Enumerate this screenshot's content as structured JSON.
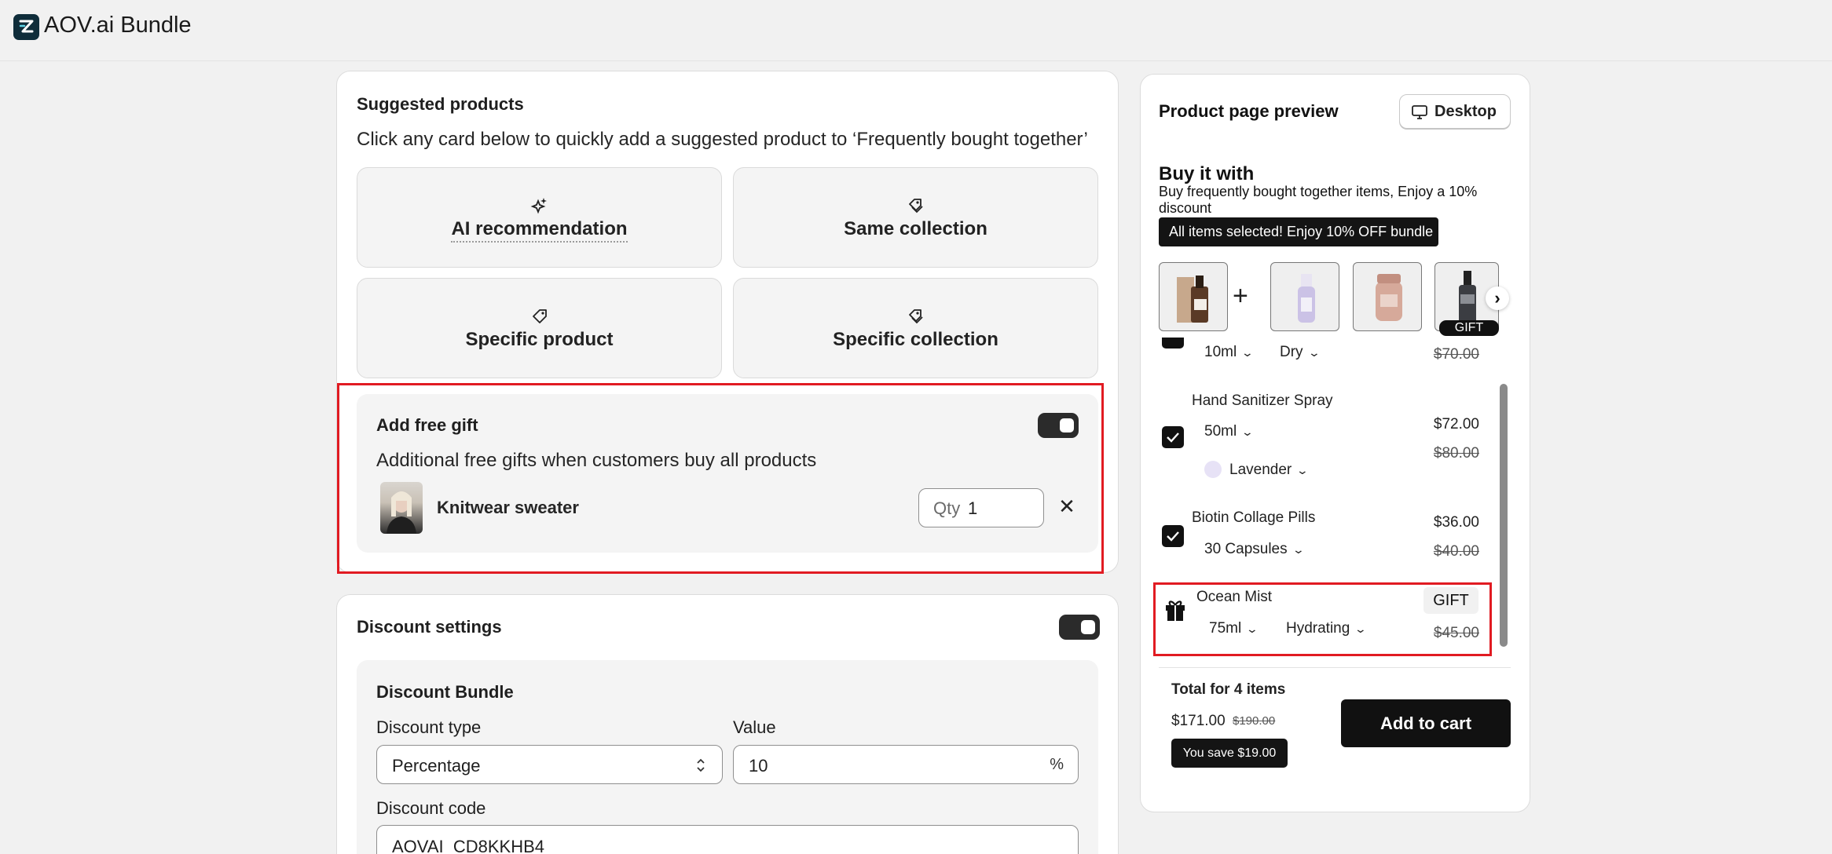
{
  "app": {
    "title": "AOV.ai Bundle"
  },
  "suggested": {
    "title": "Suggested products",
    "description": "Click any card below to quickly add a suggested product to ‘Frequently bought together’",
    "tiles": [
      {
        "label": "AI recommendation",
        "icon": "sparkle-icon"
      },
      {
        "label": "Same collection",
        "icon": "tags-icon"
      },
      {
        "label": "Specific product",
        "icon": "tag-icon"
      },
      {
        "label": "Specific collection",
        "icon": "tags-icon"
      }
    ]
  },
  "free_gift": {
    "title": "Add free gift",
    "enabled": true,
    "description": "Additional free gifts when customers buy all products",
    "item": {
      "name": "Knitwear sweater",
      "qty_label": "Qty",
      "qty": "1"
    }
  },
  "discount": {
    "title": "Discount settings",
    "enabled": true,
    "bundle_title": "Discount Bundle",
    "type_label": "Discount type",
    "type_value": "Percentage",
    "value_label": "Value",
    "value": "10",
    "value_suffix": "%",
    "code_label": "Discount code",
    "code_value": "AOVAI_CD8KKHB4"
  },
  "preview": {
    "title": "Product page preview",
    "device_label": "Desktop",
    "heading": "Buy it with",
    "subheading": "Buy frequently bought together items, Enjoy a 10% discount",
    "banner": "All items selected! Enjoy 10% OFF bundle",
    "gift_tag": "GIFT",
    "items": [
      {
        "variant1": "10ml",
        "variant2": "Dry",
        "old_price": "$70.00"
      },
      {
        "name": "Hand Sanitizer Spray",
        "variant1": "50ml",
        "variant2": "Lavender",
        "price": "$72.00",
        "old_price": "$80.00"
      },
      {
        "name": "Biotin Collage Pills",
        "variant1": "30 Capsules",
        "price": "$36.00",
        "old_price": "$40.00"
      },
      {
        "name": "Ocean Mist",
        "variant1": "75ml",
        "variant2": "Hydrating",
        "badge": "GIFT",
        "old_price": "$45.00"
      }
    ],
    "total_label": "Total for 4 items",
    "total_price": "$171.00",
    "total_old_price": "$190.00",
    "savings": "You save $19.00",
    "add_to_cart": "Add to cart"
  },
  "colors": {
    "accent_dark": "#111111",
    "highlight_red": "#e11b22",
    "panel_bg": "#f4f4f4"
  }
}
